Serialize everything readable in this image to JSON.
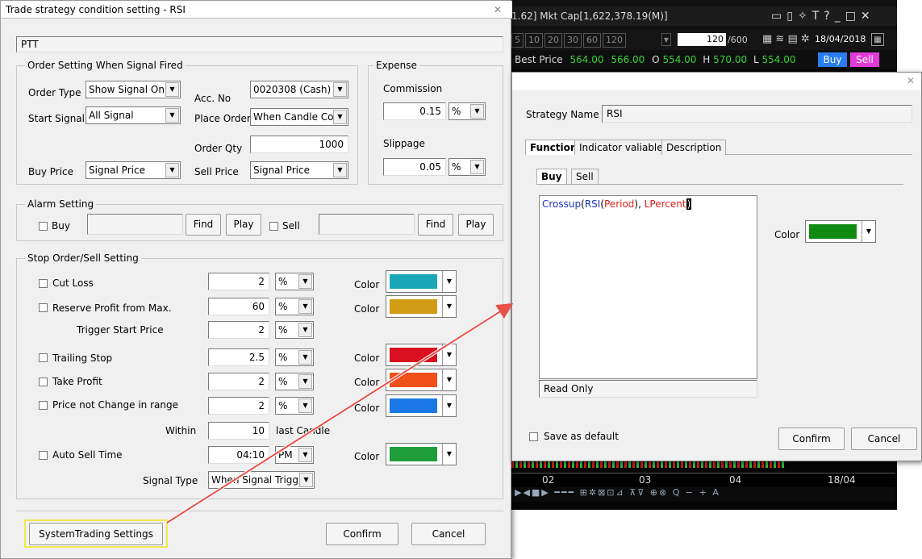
{
  "background_app": {
    "title": "1.62] Mkt Cap[1,622,378.19(M)]",
    "title_icons": [
      "window-icon",
      "restore-icon",
      "pin-icon",
      "text-icon",
      "help-icon",
      "minimize-icon",
      "maximize-icon",
      "close-icon"
    ],
    "periods": [
      "5",
      "10",
      "20",
      "30",
      "60",
      "120"
    ],
    "bars_value": "120",
    "bars_total": "/600",
    "date": "18/04/2018",
    "best_price_label": "Best Price",
    "bid": "564.00",
    "ask": "566.00",
    "open_label": "O",
    "open": "554.00",
    "high_label": "H",
    "high": "570.00",
    "low_label": "L",
    "low": "554.00",
    "buy_label": "Buy",
    "sell_label": "Sell",
    "time_labels": [
      "02",
      "03",
      "04",
      "18/04"
    ]
  },
  "left_dialog": {
    "title": "Trade strategy condition setting - RSI",
    "symbol": "PTT",
    "order_section": {
      "legend": "Order Setting When Signal Fired",
      "order_type_label": "Order Type",
      "order_type_value": "Show Signal Onl",
      "acc_no_label": "Acc. No",
      "acc_no_value": "0020308 (Cash)",
      "start_signal_label": "Start Signal",
      "start_signal_value": "All Signal",
      "place_order_label": "Place Order",
      "place_order_value": "When Candle Cor",
      "order_qty_label": "Order Qty",
      "order_qty_value": "1000",
      "buy_price_label": "Buy Price",
      "buy_price_value": "Signal Price",
      "sell_price_label": "Sell Price",
      "sell_price_value": "Signal Price"
    },
    "expense_section": {
      "legend": "Expense",
      "commission_label": "Commission",
      "commission_value": "0.15",
      "commission_unit": "%",
      "slippage_label": "Slippage",
      "slippage_value": "0.05",
      "slippage_unit": "%"
    },
    "alarm_section": {
      "legend": "Alarm Setting",
      "buy_label": "Buy",
      "sell_label": "Sell",
      "find_label": "Find",
      "play_label": "Play"
    },
    "stop_section": {
      "legend": "Stop Order/Sell Setting",
      "color_label": "Color",
      "cut_loss": {
        "label": "Cut Loss",
        "value": "2",
        "unit": "%",
        "color": "#1aa7b8"
      },
      "reserve_profit": {
        "label": "Reserve Profit from Max.",
        "value": "60",
        "unit": "%",
        "color": "#d19b14"
      },
      "trigger_start": {
        "label": "Trigger Start Price",
        "value": "2",
        "unit": "%"
      },
      "trailing_stop": {
        "label": "Trailing Stop",
        "value": "2.5",
        "unit": "%",
        "color": "#d81020"
      },
      "take_profit": {
        "label": "Take Profit",
        "value": "2",
        "unit": "%",
        "color": "#f0501a"
      },
      "price_not_change": {
        "label": "Price not Change in range",
        "value": "2",
        "unit": "%",
        "color": "#1c78e6"
      },
      "within": {
        "label": "Within",
        "value": "10",
        "suffix": "last Candle"
      },
      "auto_sell": {
        "label": "Auto Sell Time",
        "value": "04:10",
        "ampm": "PM",
        "color": "#1e9e3a"
      },
      "signal_type": {
        "label": "Signal Type",
        "value": "When Signal Trigg"
      }
    },
    "footer": {
      "system_trading_label": "SystemTrading Settings",
      "confirm_label": "Confirm",
      "cancel_label": "Cancel"
    }
  },
  "right_dialog": {
    "strategy_name_label": "Strategy Name",
    "strategy_name_value": "RSI",
    "tabs": [
      "Function",
      "Indicator valiable",
      "Description"
    ],
    "subtabs": [
      "Buy",
      "Sell"
    ],
    "code": {
      "fn": "Crossup",
      "inner_fn": "RSI",
      "arg1": "Period",
      "sep": ", ",
      "arg2": "LPercent",
      "open": "(",
      "close": ")"
    },
    "color_label": "Color",
    "color_value": "#118a11",
    "read_only_text": "Read Only",
    "save_default_label": "Save as default",
    "confirm_label": "Confirm",
    "cancel_label": "Cancel"
  }
}
